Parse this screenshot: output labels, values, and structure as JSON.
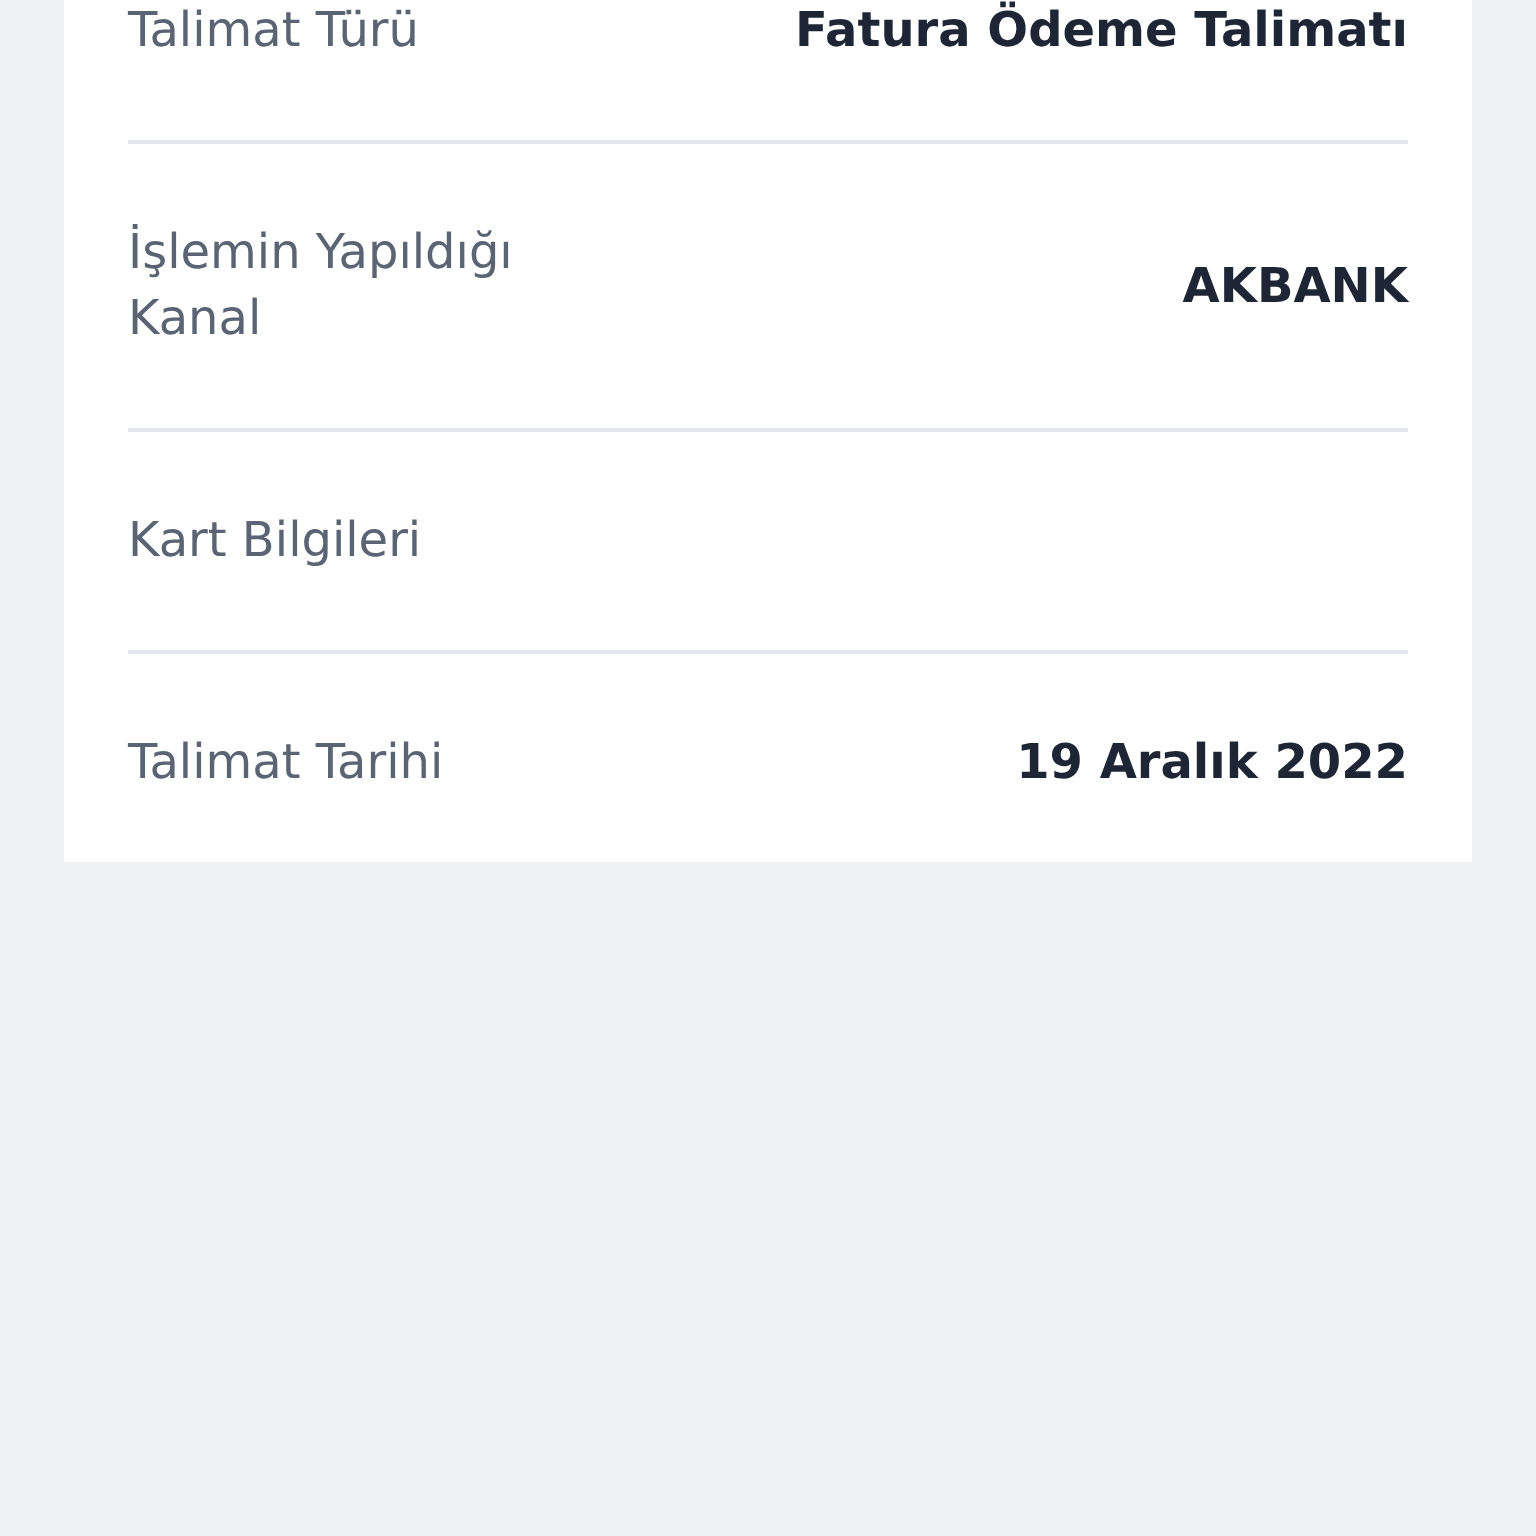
{
  "details": [
    {
      "label": "Talimat Türü",
      "value": "Fatura Ödeme Talimatı"
    },
    {
      "label": "İşlemin Yapıldığı Kanal",
      "value": "AKBANK"
    },
    {
      "label": "Kart Bilgileri"
    },
    {
      "label": "Talimat Tarihi",
      "value": "19 Aralık 2022"
    }
  ]
}
